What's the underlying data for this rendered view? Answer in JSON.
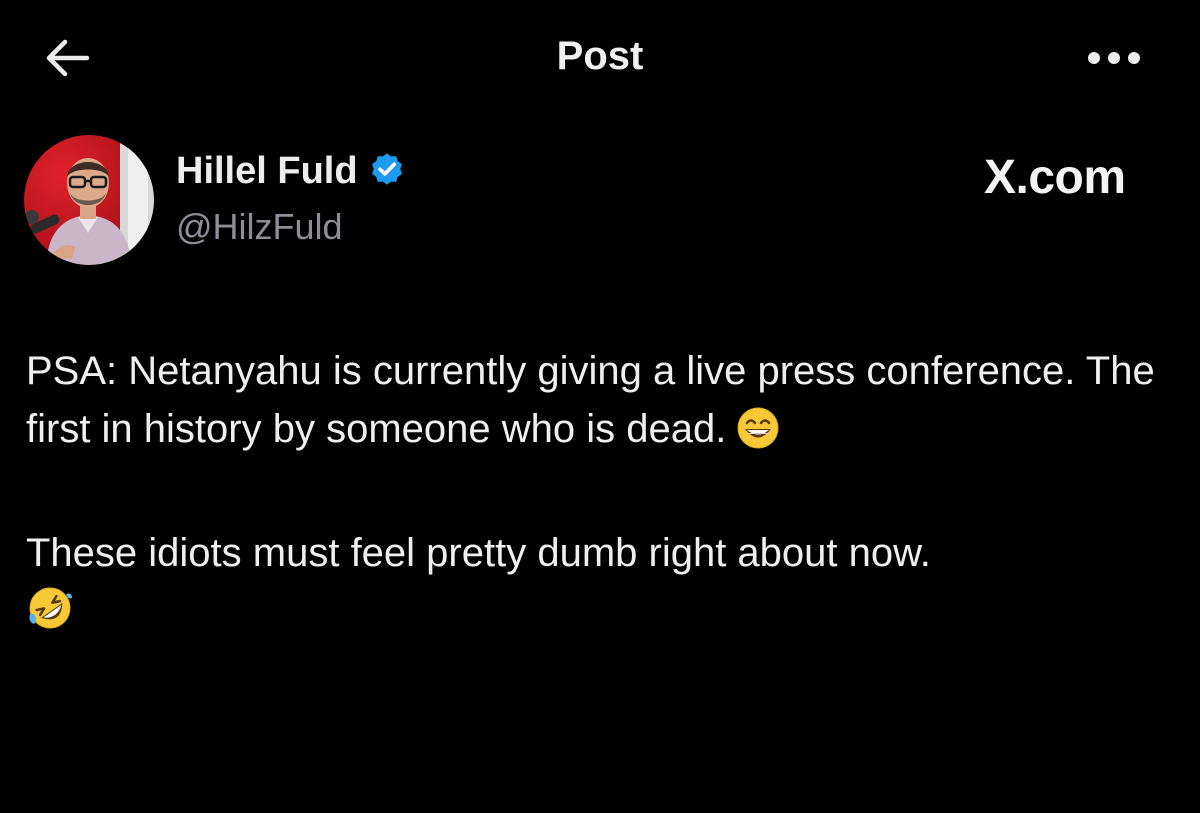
{
  "header": {
    "title": "Post",
    "back_icon": "arrow-left-icon",
    "more_icon": "more-horizontal-icon"
  },
  "author": {
    "display_name": "Hillel Fuld",
    "handle": "@HilzFuld",
    "verified_icon": "verified-badge-icon",
    "verified_color": "#1d9bf0"
  },
  "watermark": {
    "text": "X.com"
  },
  "post": {
    "paragraph_1": "PSA: Netanyahu is currently giving a live press conference. The first in history by someone who is dead.",
    "paragraph_1_emoji": "grinning-face-with-smiling-eyes-emoji",
    "paragraph_2": "These idiots must feel pretty dumb right about now.",
    "paragraph_2_emoji": "rolling-on-the-floor-laughing-emoji"
  },
  "colors": {
    "background": "#000000",
    "text_primary": "#e7e9ea",
    "text_secondary": "#8b9096",
    "accent": "#1d9bf0"
  }
}
